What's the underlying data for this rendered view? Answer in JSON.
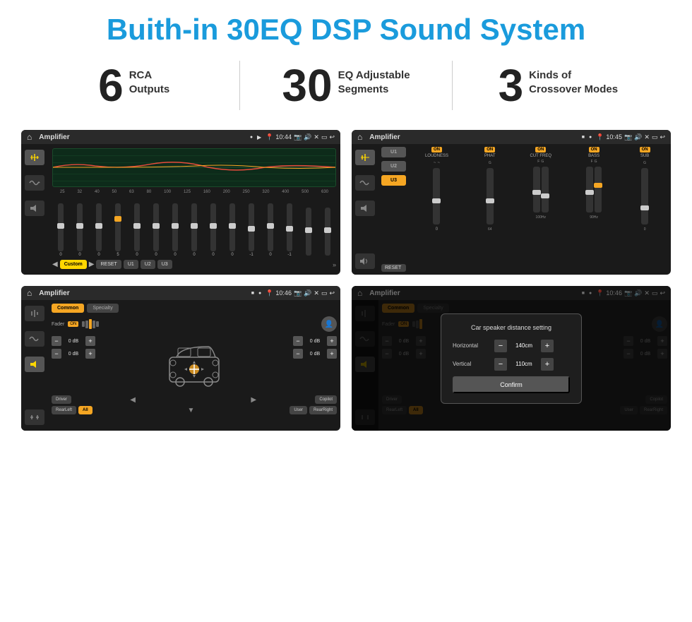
{
  "header": {
    "title": "Buith-in 30EQ DSP Sound System"
  },
  "stats": [
    {
      "number": "6",
      "label": "RCA\nOutputs"
    },
    {
      "number": "30",
      "label": "EQ Adjustable\nSegments"
    },
    {
      "number": "3",
      "label": "Kinds of\nCrossover Modes"
    }
  ],
  "screens": [
    {
      "id": "screen1",
      "topbar": {
        "time": "10:44",
        "title": "Amplifier"
      },
      "type": "eq"
    },
    {
      "id": "screen2",
      "topbar": {
        "time": "10:45",
        "title": "Amplifier"
      },
      "type": "crossover"
    },
    {
      "id": "screen3",
      "topbar": {
        "time": "10:46",
        "title": "Amplifier"
      },
      "type": "speaker"
    },
    {
      "id": "screen4",
      "topbar": {
        "time": "10:46",
        "title": "Amplifier"
      },
      "type": "speaker-dialog"
    }
  ],
  "eq": {
    "frequencies": [
      "25",
      "32",
      "40",
      "50",
      "63",
      "80",
      "100",
      "125",
      "160",
      "200",
      "250",
      "320",
      "400",
      "500",
      "630"
    ],
    "values": [
      "0",
      "0",
      "0",
      "5",
      "0",
      "0",
      "0",
      "0",
      "0",
      "0",
      "-1",
      "0",
      "-1",
      "",
      ""
    ],
    "buttons": [
      "Custom",
      "RESET",
      "U1",
      "U2",
      "U3"
    ],
    "presetName": "Custom"
  },
  "crossover": {
    "presets": [
      "U1",
      "U2",
      "U3"
    ],
    "channels": [
      "LOUDNESS",
      "PHAT",
      "CUT FREQ",
      "BASS",
      "SUB"
    ],
    "onStates": [
      true,
      true,
      true,
      true,
      true
    ]
  },
  "speaker": {
    "tabs": [
      "Common",
      "Specialty"
    ],
    "fader": "Fader",
    "faderOn": "ON",
    "dbValues": [
      "0 dB",
      "0 dB",
      "0 dB",
      "0 dB"
    ],
    "bottomBtns": [
      "Driver",
      "Copilot",
      "RearLeft",
      "All",
      "User",
      "RearRight"
    ]
  },
  "dialog": {
    "title": "Car speaker distance setting",
    "horizontal": {
      "label": "Horizontal",
      "value": "140cm"
    },
    "vertical": {
      "label": "Vertical",
      "value": "110cm"
    },
    "confirm": "Confirm"
  }
}
